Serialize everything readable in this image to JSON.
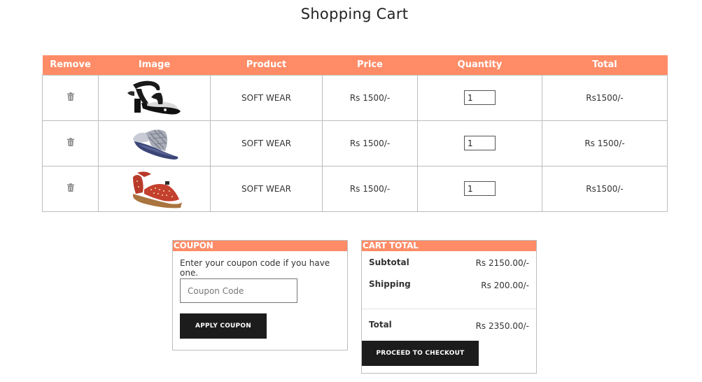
{
  "page": {
    "title": "Shopping Cart"
  },
  "table": {
    "headers": {
      "remove": "Remove",
      "image": "Image",
      "product": "Product",
      "price": "Price",
      "quantity": "Quantity",
      "total": "Total"
    },
    "rows": [
      {
        "product": "SOFT WEAR",
        "price": "Rs 1500/-",
        "quantity": "1",
        "total": "Rs1500/-",
        "image_icon": "black-heel-sandal"
      },
      {
        "product": "SOFT WEAR",
        "price": "Rs 1500/-",
        "quantity": "1",
        "total": "Rs 1500/-",
        "image_icon": "blue-flat-sandal"
      },
      {
        "product": "SOFT WEAR",
        "price": "Rs 1500/-",
        "quantity": "1",
        "total": "Rs1500/-",
        "image_icon": "red-peep-toe-flat"
      }
    ]
  },
  "coupon": {
    "header": "COUPON",
    "text": "Enter your coupon code if you have one.",
    "input_placeholder": "Coupon Code",
    "input_value": "",
    "apply_label": "APPLY COUPON"
  },
  "cart_total": {
    "header": "CART TOTAL",
    "subtotal_label": "Subtotal",
    "subtotal_value": "Rs 2150.00/-",
    "shipping_label": "Shipping",
    "shipping_value": "Rs 200.00/-",
    "total_label": "Total",
    "total_value": "Rs 2350.00/-",
    "checkout_label": "PROCEED TO CHECKOUT"
  },
  "colors": {
    "accent": "#ff8c67",
    "button_dark": "#1c1c1c",
    "border": "#bdbdbd"
  }
}
